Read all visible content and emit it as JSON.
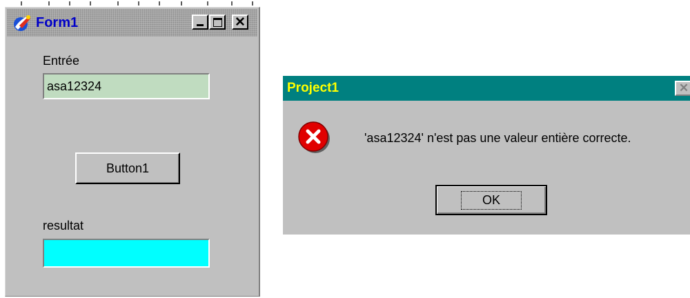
{
  "form1": {
    "title": "Form1",
    "input_label": "Entrée",
    "input_value": "asa12324",
    "button_label": "Button1",
    "result_label": "resultat",
    "result_value": "",
    "close_glyph": "✕"
  },
  "dialog": {
    "title": "Project1",
    "message": "'asa12324' n'est pas une valeur entière correcte.",
    "ok_label": "OK",
    "close_glyph": "✕"
  },
  "colors": {
    "input_bg": "#c0dcc0",
    "result_bg": "#00ffff",
    "dialog_title_bg": "#008080",
    "dialog_title_text": "#ffff00",
    "form_title_text": "#0000c8"
  },
  "icons": [
    "app-icon",
    "minimize-icon",
    "maximize-icon",
    "close-icon",
    "error-icon"
  ]
}
